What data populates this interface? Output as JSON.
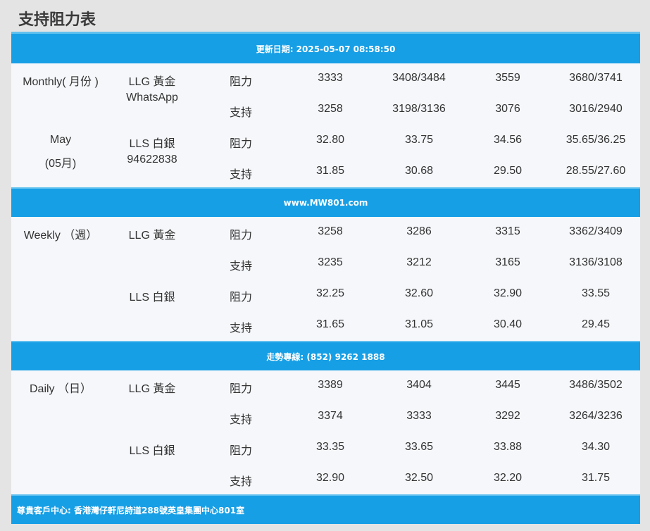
{
  "page_title": "支持阻力表",
  "banners": {
    "update": "更新日期: 2025-05-07 08:58:50",
    "website": "www.MW801.com",
    "hotline": "走勢專線: (852) 9262 1888",
    "address": "尊貴客戶中心: 香港灣仔軒尼詩道288號英皇集團中心801室"
  },
  "monthly": {
    "period_line1": "Monthly( 月份 )",
    "period_line2": "May",
    "period_line3": "(05月)",
    "llg_label": "LLG 黃金",
    "whatsapp_label": "WhatsApp",
    "lls_label": "LLS 白銀",
    "phone": "94622838",
    "rows": [
      {
        "type": "阻力",
        "v1": "3333",
        "v2": "3408/3484",
        "v3": "3559",
        "v4": "3680/3741"
      },
      {
        "type": "支持",
        "v1": "3258",
        "v2": "3198/3136",
        "v3": "3076",
        "v4": "3016/2940"
      },
      {
        "type": "阻力",
        "v1": "32.80",
        "v2": "33.75",
        "v3": "34.56",
        "v4": "35.65/36.25"
      },
      {
        "type": "支持",
        "v1": "31.85",
        "v2": "30.68",
        "v3": "29.50",
        "v4": "28.55/27.60"
      }
    ]
  },
  "weekly": {
    "period": "Weekly （週）",
    "llg_label": "LLG 黃金",
    "lls_label": "LLS 白銀",
    "rows": [
      {
        "type": "阻力",
        "v1": "3258",
        "v2": "3286",
        "v3": "3315",
        "v4": "3362/3409"
      },
      {
        "type": "支持",
        "v1": "3235",
        "v2": "3212",
        "v3": "3165",
        "v4": "3136/3108"
      },
      {
        "type": "阻力",
        "v1": "32.25",
        "v2": "32.60",
        "v3": "32.90",
        "v4": "33.55"
      },
      {
        "type": "支持",
        "v1": "31.65",
        "v2": "31.05",
        "v3": "30.40",
        "v4": "29.45"
      }
    ]
  },
  "daily": {
    "period": "Daily （日）",
    "llg_label": "LLG 黃金",
    "lls_label": "LLS 白銀",
    "rows": [
      {
        "type": "阻力",
        "v1": "3389",
        "v2": "3404",
        "v3": "3445",
        "v4": "3486/3502"
      },
      {
        "type": "支持",
        "v1": "3374",
        "v2": "3333",
        "v3": "3292",
        "v4": "3264/3236"
      },
      {
        "type": "阻力",
        "v1": "33.35",
        "v2": "33.65",
        "v3": "33.88",
        "v4": "34.30"
      },
      {
        "type": "支持",
        "v1": "32.90",
        "v2": "32.50",
        "v3": "32.20",
        "v4": "31.75"
      }
    ]
  }
}
